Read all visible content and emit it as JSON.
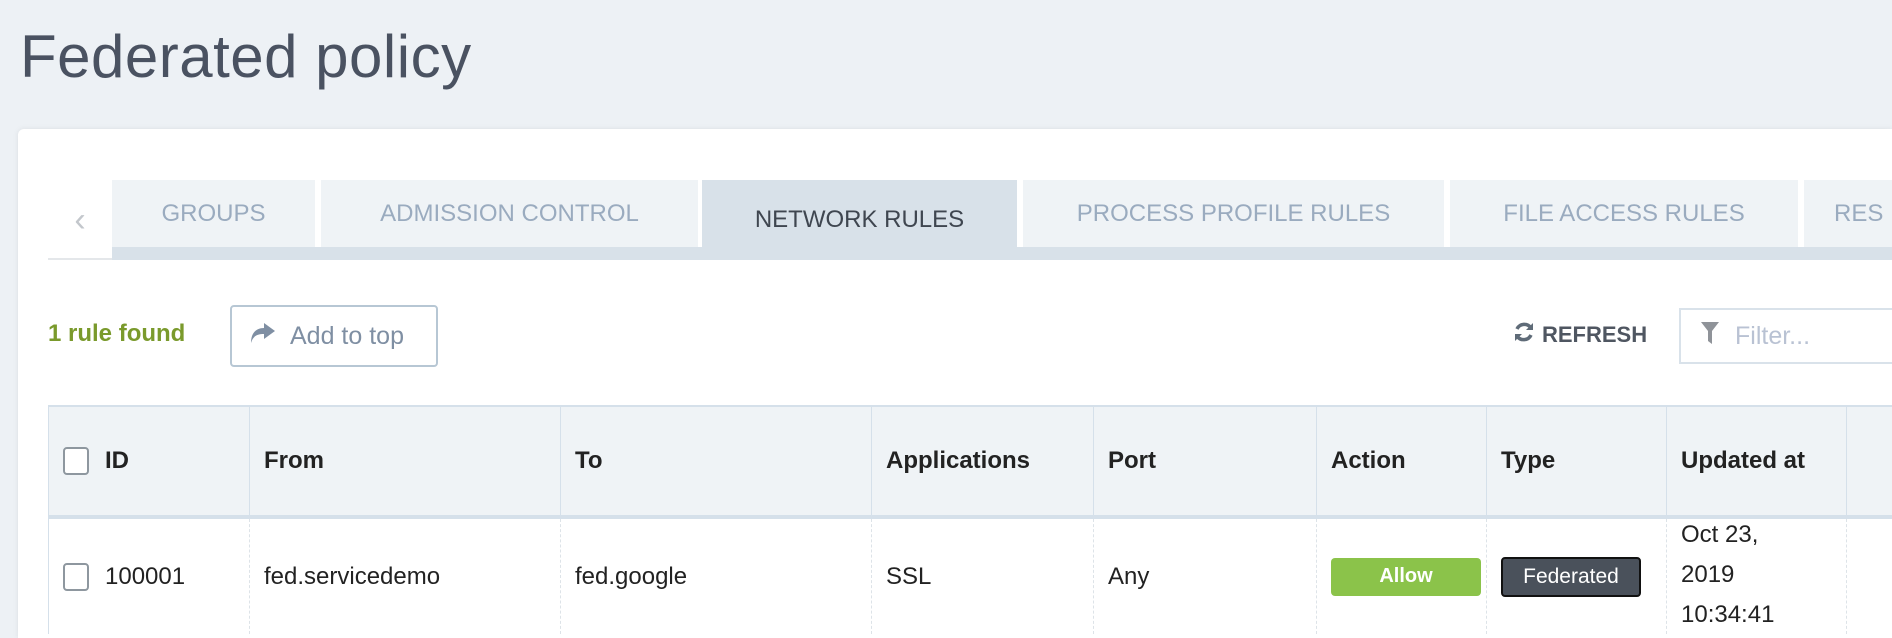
{
  "page": {
    "title": "Federated policy"
  },
  "tabs": [
    {
      "label": "GROUPS",
      "active": false
    },
    {
      "label": "ADMISSION CONTROL",
      "active": false
    },
    {
      "label": "NETWORK RULES",
      "active": true
    },
    {
      "label": "PROCESS PROFILE RULES",
      "active": false
    },
    {
      "label": "FILE ACCESS RULES",
      "active": false
    },
    {
      "label": "RES",
      "active": false
    }
  ],
  "toolbar": {
    "count": "1 rule found",
    "add_label": "Add to top",
    "refresh_label": "REFRESH",
    "filter_placeholder": "Filter..."
  },
  "table": {
    "headers": [
      "ID",
      "From",
      "To",
      "Applications",
      "Port",
      "Action",
      "Type",
      "Updated at"
    ],
    "rows": [
      {
        "id": "100001",
        "from": "fed.servicedemo",
        "to": "fed.google",
        "applications": "SSL",
        "port": "Any",
        "action": "Allow",
        "type": "Federated",
        "updated": [
          "Oct 23,",
          "2019",
          "10:34:41"
        ]
      }
    ]
  },
  "colors": {
    "allow": "#8bc34a",
    "federated": "#4a515b",
    "count": "#7a9a2c"
  }
}
